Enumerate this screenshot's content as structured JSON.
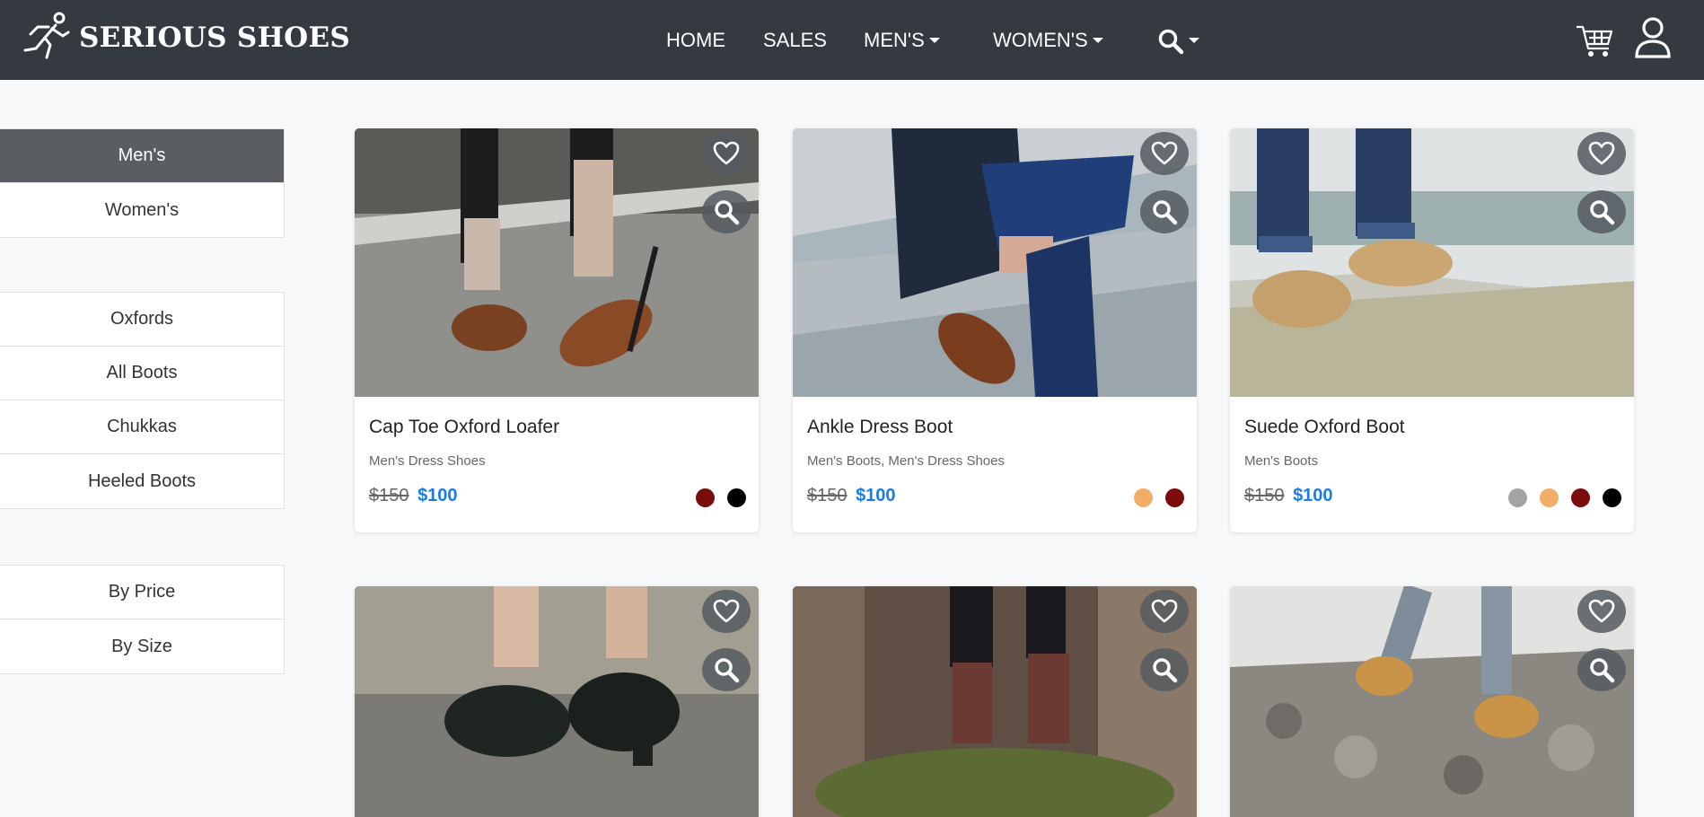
{
  "brand": {
    "name": "SERIOUS SHOES"
  },
  "nav": {
    "home": "HOME",
    "sales": "SALES",
    "mens": "MEN'S",
    "womens": "WOMEN'S"
  },
  "sidebar": {
    "gender": [
      {
        "label": "Men's",
        "active": true
      },
      {
        "label": "Women's",
        "active": false
      }
    ],
    "styles": [
      {
        "label": "Oxfords"
      },
      {
        "label": "All Boots"
      },
      {
        "label": "Chukkas"
      },
      {
        "label": "Heeled Boots"
      }
    ],
    "sort": [
      {
        "label": "By Price"
      },
      {
        "label": "By Size"
      }
    ]
  },
  "colors": {
    "navbar": "#343a40",
    "accent": "#1a7de6",
    "active_sidebar": "#5a5e63"
  },
  "products": [
    {
      "title": "Cap Toe Oxford Loafer",
      "category": "Men's Dress Shoes",
      "old_price": "$150",
      "price": "$100",
      "swatches": [
        "#7a0c0c",
        "#000000"
      ]
    },
    {
      "title": "Ankle Dress Boot",
      "category": "Men's Boots, Men's Dress Shoes",
      "old_price": "$150",
      "price": "$100",
      "swatches": [
        "#f2ad66",
        "#7a0c0c"
      ]
    },
    {
      "title": "Suede Oxford Boot",
      "category": "Men's Boots",
      "old_price": "$150",
      "price": "$100",
      "swatches": [
        "#a3a3a3",
        "#f2ad66",
        "#7a0c0c",
        "#000000"
      ]
    },
    {
      "title": "",
      "category": "",
      "old_price": "",
      "price": "",
      "swatches": []
    },
    {
      "title": "",
      "category": "",
      "old_price": "",
      "price": "",
      "swatches": []
    },
    {
      "title": "",
      "category": "",
      "old_price": "",
      "price": "",
      "swatches": []
    }
  ]
}
